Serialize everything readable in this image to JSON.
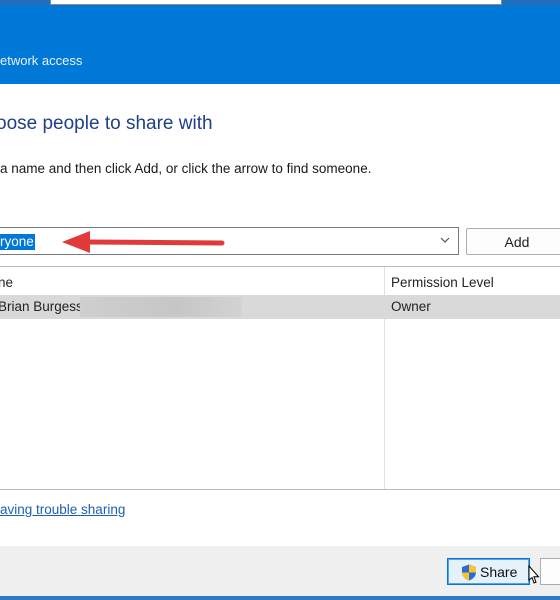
{
  "window": {
    "title": "Network access"
  },
  "heading": "Choose people to share with",
  "instructions": "Type a name and then click Add, or click the arrow to find someone.",
  "search": {
    "value": "Everyone",
    "shown_value": "ryone",
    "add_label": "Add"
  },
  "table": {
    "headers": [
      "Name",
      "Permission Level"
    ],
    "shown_headers": [
      "ne",
      "Permission Level"
    ],
    "rows": [
      {
        "name": "Brian Burgess",
        "shown_name": "Brian Burgess",
        "permission": "Owner"
      }
    ]
  },
  "link": {
    "label": "I'm having trouble sharing",
    "shown_label": "aving trouble sharing"
  },
  "buttons": {
    "share_label": "Share"
  },
  "colors": {
    "titlebar": "#0078d7",
    "heading": "#1e3f8a",
    "link": "#1d5fb5",
    "annotation_arrow": "#e03a3a",
    "row_selected": "#d9d9d9"
  },
  "icons": {
    "dropdown": "chevron-down-icon",
    "share": "uac-shield-icon",
    "cursor": "mouse-pointer-icon",
    "annotation": "red-arrow-icon"
  }
}
